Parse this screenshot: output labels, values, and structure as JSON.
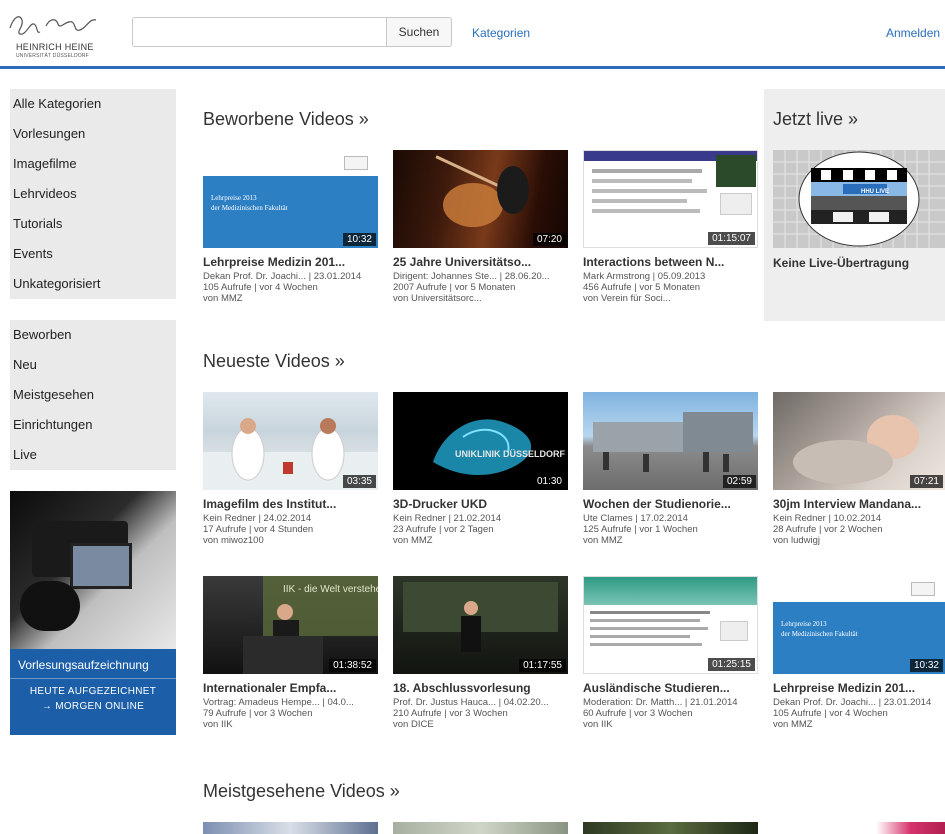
{
  "header": {
    "logo_line1": "HEINRICH HEINE",
    "logo_line2": "UNIVERSITÄT DÜSSELDORF",
    "search_placeholder": "",
    "search_button": "Suchen",
    "categories_link": "Kategorien",
    "login_link": "Anmelden",
    "accent_color": "#2a6ebb"
  },
  "sidebar": {
    "group1": [
      "Alle Kategorien",
      "Vorlesungen",
      "Imagefilme",
      "Lehrvideos",
      "Tutorials",
      "Events",
      "Unkategorisiert"
    ],
    "group2": [
      "Beworben",
      "Neu",
      "Meistgesehen",
      "Einrichtungen",
      "Live"
    ],
    "banner": {
      "title": "Vorlesungsaufzeichnung",
      "line1": "HEUTE AUFGEZEICHNET",
      "line2": "→ MORGEN ONLINE"
    }
  },
  "sections": {
    "featured": "Beworbene Videos »",
    "newest": "Neueste Videos »",
    "most_viewed": "Meistgesehene Videos »",
    "live": "Jetzt live »"
  },
  "live": {
    "status": "Keine Live-Übertragung",
    "logo": "HHU LIVE"
  },
  "thumb_text": {
    "lehrpreis_1": "Lehrpreise 2013",
    "lehrpreis_2": "der Medizinischen Fakultät",
    "uniklinik": "UNIKLINIK DÜSSELDORF",
    "iik_wall": "IIK - die Welt verstehen"
  },
  "featured_videos": [
    {
      "title": "Lehrpreise Medizin 201...",
      "meta": "Dekan Prof. Dr. Joachi... | 23.01.2014",
      "views": "105 Aufrufe | vor 4 Wochen",
      "by": "von MMZ",
      "duration": "10:32"
    },
    {
      "title": "25 Jahre Universitätso...",
      "meta": "Dirigent: Johannes Ste... | 28.06.20...",
      "views": "2007 Aufrufe | vor 5 Monaten",
      "by": "von Universitätsorc...",
      "duration": "07:20"
    },
    {
      "title": "Interactions between N...",
      "meta": "Mark Armstrong | 05.09.2013",
      "views": "456 Aufrufe | vor 5 Monaten",
      "by": "von Verein für Soci...",
      "duration": "01:15:07"
    }
  ],
  "newest_videos": [
    {
      "title": "Imagefilm des Institut...",
      "meta": "Kein Redner | 24.02.2014",
      "views": "17 Aufrufe | vor 4 Stunden",
      "by": "von miwoz100",
      "duration": "03:35"
    },
    {
      "title": "3D-Drucker UKD",
      "meta": "Kein Redner | 21.02.2014",
      "views": "23 Aufrufe | vor 2 Tagen",
      "by": "von MMZ",
      "duration": "01:30"
    },
    {
      "title": "Wochen der Studienorie...",
      "meta": "Ute Clames | 17.02.2014",
      "views": "125 Aufrufe | vor 1 Wochen",
      "by": "von MMZ",
      "duration": "02:59"
    },
    {
      "title": "30jm Interview Mandana...",
      "meta": "Kein Redner | 10.02.2014",
      "views": "28 Aufrufe | vor 2 Wochen",
      "by": "von ludwigj",
      "duration": "07:21"
    },
    {
      "title": "Internationaler Empfa...",
      "meta": "Vortrag: Amadeus Hempe... | 04.0...",
      "views": "79 Aufrufe | vor 3 Wochen",
      "by": "von IIK",
      "duration": "01:38:52"
    },
    {
      "title": "18. Abschlussvorlesung",
      "meta": "Prof. Dr. Justus Hauca... | 04.02.20...",
      "views": "210 Aufrufe | vor 3 Wochen",
      "by": "von DICE",
      "duration": "01:17:55"
    },
    {
      "title": "Ausländische Studieren...",
      "meta": "Moderation: Dr. Matth... | 21.01.2014",
      "views": "60 Aufrufe | vor 3 Wochen",
      "by": "von IIK",
      "duration": "01:25:15"
    },
    {
      "title": "Lehrpreise Medizin 201...",
      "meta": "Dekan Prof. Dr. Joachi... | 23.01.2014",
      "views": "105 Aufrufe | vor 4 Wochen",
      "by": "von MMZ",
      "duration": "10:32"
    }
  ]
}
